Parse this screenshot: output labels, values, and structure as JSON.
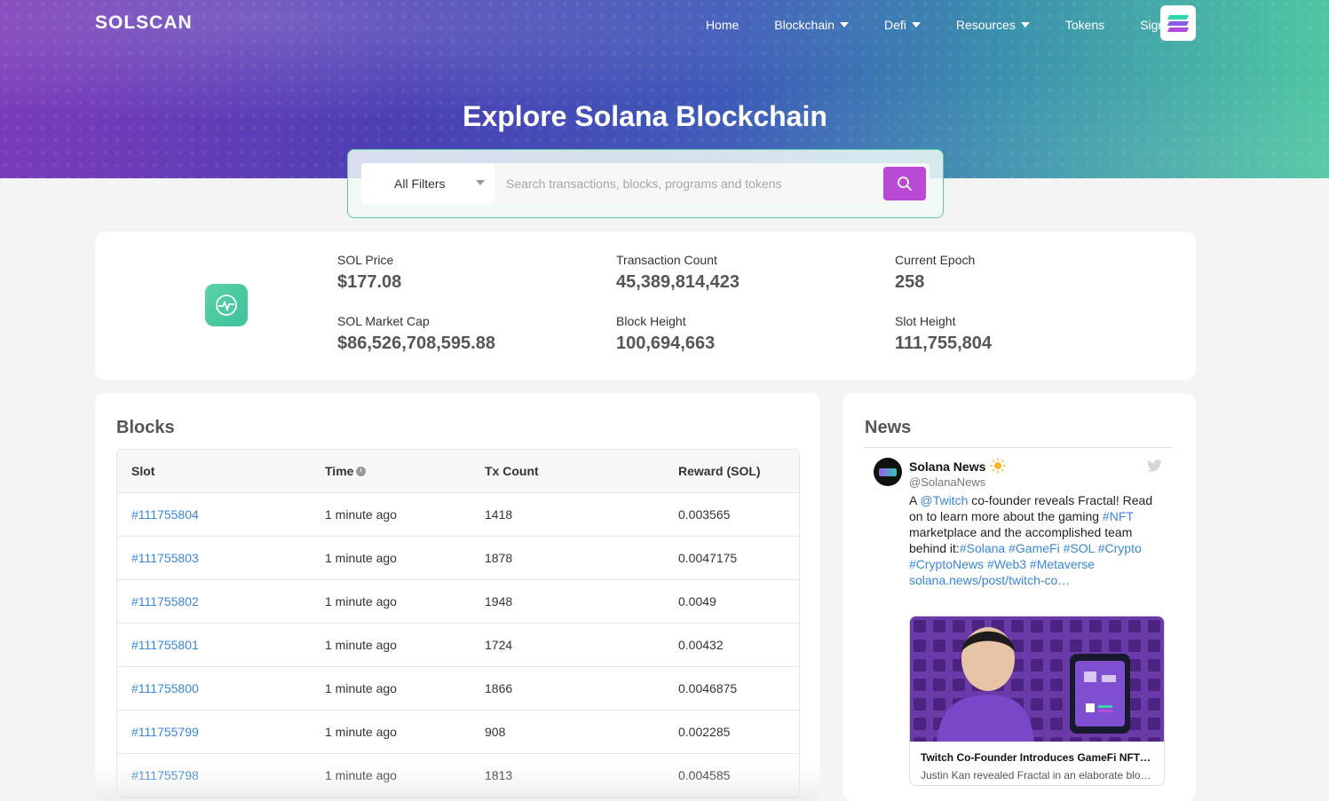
{
  "brand": {
    "logo": "SOLSCAN"
  },
  "nav": {
    "items": [
      {
        "label": "Home",
        "dropdown": false
      },
      {
        "label": "Blockchain",
        "dropdown": true
      },
      {
        "label": "Defi",
        "dropdown": true
      },
      {
        "label": "Resources",
        "dropdown": true
      },
      {
        "label": "Tokens",
        "dropdown": false
      },
      {
        "label": "Sign in",
        "dropdown": false
      }
    ]
  },
  "hero": {
    "title": "Explore Solana Blockchain"
  },
  "search": {
    "filter_label": "All Filters",
    "placeholder": "Search transactions, blocks, programs and tokens"
  },
  "stats": {
    "sol_price_label": "SOL Price",
    "sol_price": "$177.08",
    "market_cap_label": "SOL Market Cap",
    "market_cap": "$86,526,708,595.88",
    "tx_count_label": "Transaction Count",
    "tx_count": "45,389,814,423",
    "block_height_label": "Block Height",
    "block_height": "100,694,663",
    "epoch_label": "Current Epoch",
    "epoch": "258",
    "slot_height_label": "Slot Height",
    "slot_height": "111,755,804"
  },
  "blocks": {
    "title": "Blocks",
    "columns": [
      "Slot",
      "Time",
      "Tx Count",
      "Reward (SOL)"
    ],
    "rows": [
      {
        "slot": "#111755804",
        "time": "1 minute ago",
        "tx": "1418",
        "reward": "0.003565"
      },
      {
        "slot": "#111755803",
        "time": "1 minute ago",
        "tx": "1878",
        "reward": "0.0047175"
      },
      {
        "slot": "#111755802",
        "time": "1 minute ago",
        "tx": "1948",
        "reward": "0.0049"
      },
      {
        "slot": "#111755801",
        "time": "1 minute ago",
        "tx": "1724",
        "reward": "0.00432"
      },
      {
        "slot": "#111755800",
        "time": "1 minute ago",
        "tx": "1866",
        "reward": "0.0046875"
      },
      {
        "slot": "#111755799",
        "time": "1 minute ago",
        "tx": "908",
        "reward": "0.002285"
      },
      {
        "slot": "#111755798",
        "time": "1 minute ago",
        "tx": "1813",
        "reward": "0.004585"
      }
    ]
  },
  "news": {
    "title": "News",
    "account_name": "Solana News",
    "account_handle": "@SolanaNews",
    "tweet_parts": [
      {
        "t": "A ",
        "link": false
      },
      {
        "t": "@Twitch",
        "link": true
      },
      {
        "t": " co-founder reveals Fractal! Read on to learn more about the gaming ",
        "link": false
      },
      {
        "t": "#NFT",
        "link": true
      },
      {
        "t": " marketplace and the accomplished team behind it:",
        "link": false
      },
      {
        "t": "#Solana",
        "link": true
      },
      {
        "t": " ",
        "link": false
      },
      {
        "t": "#GameFi",
        "link": true
      },
      {
        "t": " ",
        "link": false
      },
      {
        "t": "#SOL",
        "link": true
      },
      {
        "t": " ",
        "link": false
      },
      {
        "t": "#Crypto",
        "link": true
      },
      {
        "t": " ",
        "link": false
      },
      {
        "t": "#CryptoNews",
        "link": true
      },
      {
        "t": " ",
        "link": false
      },
      {
        "t": "#Web3",
        "link": true
      },
      {
        "t": " ",
        "link": false
      },
      {
        "t": "#Metaverse",
        "link": true
      },
      {
        "t": " ",
        "link": false
      },
      {
        "t": "solana.news/post/twitch-co…",
        "link": true
      }
    ],
    "card_title": "Twitch Co-Founder Introduces GameFi NFT…",
    "card_desc": "Justin Kan revealed Fractal in an elaborate blo…"
  }
}
